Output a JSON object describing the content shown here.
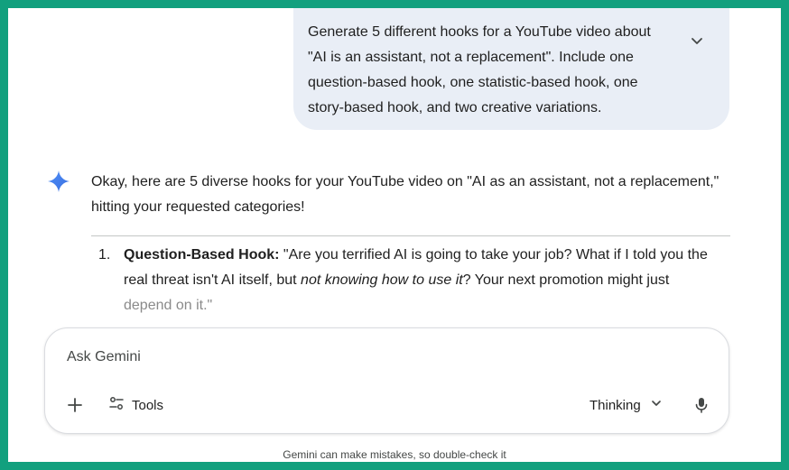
{
  "user_message": {
    "lines": [
      "Generate 5 different hooks for a YouTube video about",
      "\"AI is an assistant, not a replacement\". Include one",
      "question-based hook, one statistic-based hook, one",
      "story-based hook, and two creative variations."
    ]
  },
  "response": {
    "intro_lines": [
      "Okay, here are 5 diverse hooks for your YouTube video on \"AI as an assistant, not a replacement,\"",
      "hitting your requested categories!"
    ],
    "item1": {
      "number": "1.",
      "title": "Question-Based Hook:",
      "text_a": " \"Are you terrified AI is going to take your job? What if I told you the",
      "text_b": "real threat isn't AI itself, but ",
      "text_italic": "not knowing how to use it",
      "text_c": "? Your next promotion might just",
      "text_d": "depend on it.\""
    }
  },
  "input": {
    "placeholder": "Ask Gemini",
    "tools_label": "Tools",
    "mode_label": "Thinking"
  },
  "footer": {
    "disclaimer": "Gemini can make mistakes, so double-check it"
  },
  "colors": {
    "frame": "#12a07e",
    "bubble": "#e9eef6",
    "spark_blue": "#4285f4"
  },
  "icons": [
    "chevron-down-icon",
    "gemini-spark-icon",
    "plus-icon",
    "tools-icon",
    "chevron-down-icon",
    "mic-icon"
  ]
}
